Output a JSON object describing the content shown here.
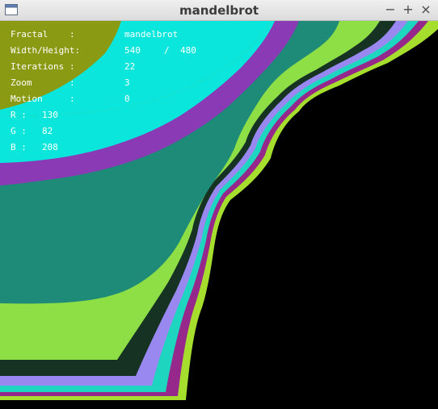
{
  "window": {
    "title": "mandelbrot",
    "minimize_label": "−",
    "maximize_label": "+",
    "close_label": "×"
  },
  "info": {
    "fractal_label": "Fractal",
    "fractal_value": "mandelbrot",
    "size_label": "Width/Height:",
    "width_value": "540",
    "size_separator": "/",
    "height_value": "480",
    "iterations_label": "Iterations",
    "iterations_value": "22",
    "zoom_label": "Zoom",
    "zoom_value": "3",
    "motion_label": "Motion",
    "motion_value": "0",
    "colon": ":",
    "r_label": "R :",
    "r_value": "130",
    "g_label": "G :",
    "g_value": "82",
    "b_label": "B :",
    "b_value": "208"
  },
  "palette": {
    "olive": "#8a9a12",
    "cyan": "#0be6dc",
    "purple": "#8a3ab4",
    "teal": "#1e8a78",
    "lime": "#8ede46",
    "dark_green": "#163222",
    "lavender": "#9888f0",
    "aqua": "#1ed6c0",
    "magenta": "#96288c",
    "yellow_green": "#a6de2e",
    "background": "#000000"
  }
}
